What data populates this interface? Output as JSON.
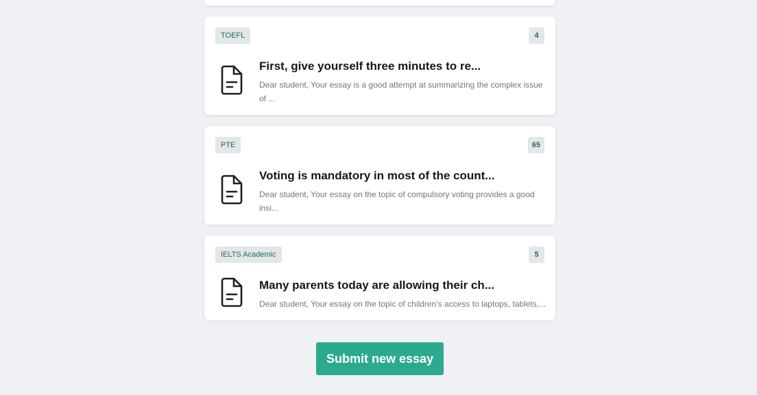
{
  "essays": [
    {
      "tag": "TOEFL",
      "score": "4",
      "title": "First, give yourself three minutes to re...",
      "excerpt": "Dear student, Your essay is a good attempt at summarizing the complex issue of ..."
    },
    {
      "tag": "PTE",
      "score": "65",
      "title": "Voting is mandatory in most of the count...",
      "excerpt": "Dear student, Your essay on the topic of compulsory voting provides a good insi..."
    },
    {
      "tag": "IELTS Academic",
      "score": "5",
      "title": "Many parents today are allowing their ch...",
      "excerpt": "Dear student, Your essay on the topic of children’s access to laptops, tablets,..."
    }
  ],
  "submit_button": {
    "label": "Submit new essay"
  },
  "icons": {
    "essay": "document-icon"
  },
  "colors": {
    "accent": "#2baa8e",
    "tag_text": "#1f6b5c",
    "tag_bg": "#e3e6ea",
    "background": "#eff1f5"
  }
}
